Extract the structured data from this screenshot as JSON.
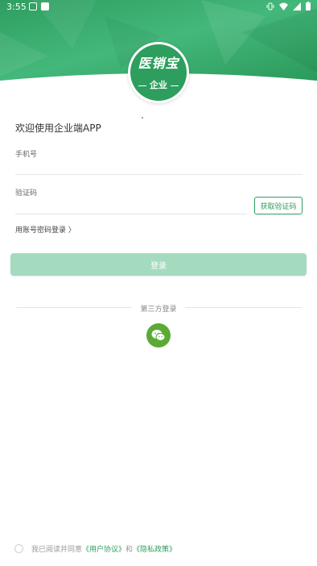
{
  "status_bar": {
    "time": "3:55"
  },
  "logo": {
    "title": "医销宝",
    "subtitle": "企业"
  },
  "welcome": "欢迎使用企业端APP",
  "phone": {
    "label": "手机号",
    "value": ""
  },
  "code": {
    "label": "验证码",
    "value": "",
    "button_label": "获取验证码"
  },
  "password_login_link": "用账号密码登录 〉",
  "login_button": "登录",
  "third_party": {
    "label": "第三方登录",
    "wechat_icon": "wechat-icon"
  },
  "agreement": {
    "prefix": "我已阅读并同意",
    "user_agreement": "《用户协议》",
    "and": "和",
    "privacy_policy": "《隐私政策》"
  },
  "colors": {
    "brand_green": "#2e9e5e",
    "login_button_disabled": "#a4dbbf",
    "wechat_green": "#5aaa34"
  }
}
